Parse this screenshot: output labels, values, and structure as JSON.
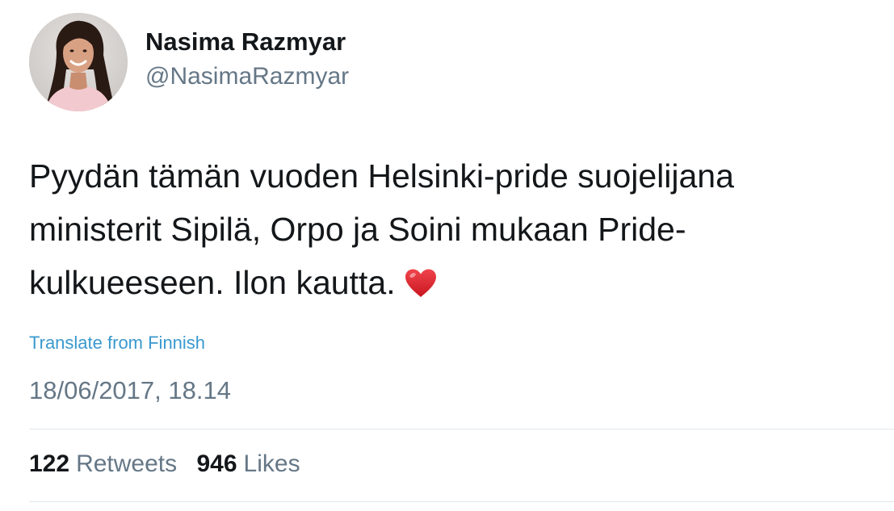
{
  "author": {
    "display_name": "Nasima Razmyar",
    "handle": "@NasimaRazmyar",
    "avatar_icon": "profile-photo"
  },
  "tweet": {
    "lines": [
      "Pyydän tämän vuoden Helsinki-pride suojelijana",
      "ministerit Sipilä, Orpo ja Soini mukaan Pride-",
      "kulkueeseen. Ilon kautta."
    ],
    "emoji": "heart-icon",
    "translate_label": "Translate from Finnish",
    "timestamp": "18/06/2017, 18.14"
  },
  "stats": {
    "retweets_count": "122",
    "retweets_label": "Retweets",
    "likes_count": "946",
    "likes_label": "Likes"
  },
  "colors": {
    "text": "#14171a",
    "secondary": "#657786",
    "link": "#3a99cf",
    "heart": "#e0242f",
    "divider": "#e1e8ed"
  }
}
